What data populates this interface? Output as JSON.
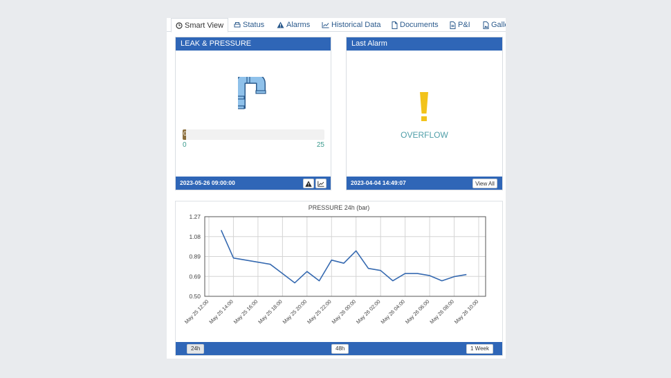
{
  "tabs": [
    {
      "label": "Smart View",
      "icon": "clock-icon",
      "active": true
    },
    {
      "label": "Status",
      "icon": "printer-icon"
    },
    {
      "label": "Alarms",
      "icon": "warning-icon"
    },
    {
      "label": "Historical Data",
      "icon": "line-chart-icon"
    },
    {
      "label": "Documents",
      "icon": "document-icon"
    },
    {
      "label": "P&I",
      "icon": "pdf-icon"
    },
    {
      "label": "Galle",
      "icon": "image-icon"
    }
  ],
  "leak_panel": {
    "title": "LEAK & PRESSURE",
    "gauge": {
      "value": "0",
      "min": "0",
      "max": "25",
      "fill_fraction": 0.02
    },
    "timestamp": "2023-05-26 09:00:00",
    "icons": [
      "warning-icon",
      "chart-icon"
    ]
  },
  "alarm_panel": {
    "title": "Last Alarm",
    "alarm": "OVERFLOW",
    "timestamp": "2023-04-04 14:49:07",
    "view_all": "View All"
  },
  "range_buttons": [
    "24h",
    "48h",
    "1 Week"
  ],
  "colors": {
    "accent": "#2f66b7",
    "line": "#3569b0",
    "alarm": "#f2c31b",
    "pipe": "#8fc1ea"
  },
  "chart_data": {
    "type": "line",
    "title": "PRESSURE 24h (bar)",
    "y_ticks": [
      "1.27",
      "1.08",
      "0.89",
      "0.69",
      "0.50"
    ],
    "ylim": [
      0.5,
      1.27
    ],
    "x_ticks": [
      "May 25 12:00",
      "May 25 14:00",
      "May 25 16:00",
      "May 25 18:00",
      "May 25 20:00",
      "May 25 22:00",
      "May 26 00:00",
      "May 26 02:00",
      "May 26 04:00",
      "May 26 06:00",
      "May 26 08:00",
      "May 26 10:00"
    ],
    "x": [
      "May 25 13:00",
      "May 25 14:00",
      "May 25 15:00",
      "May 25 16:00",
      "May 25 17:00",
      "May 25 18:00",
      "May 25 19:00",
      "May 25 20:00",
      "May 25 21:00",
      "May 25 22:00",
      "May 25 23:00",
      "May 26 00:00",
      "May 26 01:00",
      "May 26 02:00",
      "May 26 03:00",
      "May 26 04:00",
      "May 26 05:00",
      "May 26 06:00",
      "May 26 07:00",
      "May 26 08:00",
      "May 26 09:00"
    ],
    "values": [
      1.14,
      0.87,
      0.85,
      0.83,
      0.81,
      0.72,
      0.63,
      0.74,
      0.65,
      0.85,
      0.82,
      0.94,
      0.77,
      0.75,
      0.65,
      0.72,
      0.72,
      0.7,
      0.65,
      0.69,
      0.71
    ],
    "grid": true,
    "legend": "none"
  }
}
